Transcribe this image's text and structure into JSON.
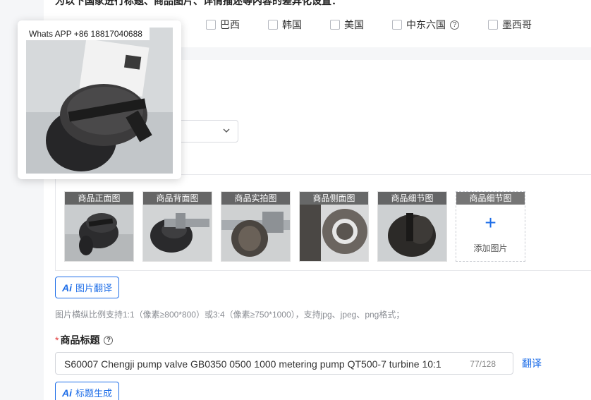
{
  "top_note": "为以下国家进行标题、商品图片、详情描述等内容的差异化设置：",
  "countries": [
    {
      "label": "巴西",
      "help": false
    },
    {
      "label": "韩国",
      "help": false
    },
    {
      "label": "美国",
      "help": false
    },
    {
      "label": "中东六国",
      "help": true
    },
    {
      "label": "墨西哥",
      "help": false
    }
  ],
  "help_glyph": "?",
  "images": [
    {
      "caption": "商品正面图"
    },
    {
      "caption": "商品背面图"
    },
    {
      "caption": "商品实拍图"
    },
    {
      "caption": "商品侧面图"
    },
    {
      "caption": "商品细节图"
    }
  ],
  "add_slot": {
    "caption": "商品细节图",
    "plus": "+",
    "label": "添加图片"
  },
  "image_translate_button": {
    "ai": "Ai",
    "label": "图片翻译"
  },
  "image_hint": "图片横纵比例支持1:1（像素≥800*800）或3:4（像素≥750*1000），支持jpg、jpeg、png格式；",
  "title_field": {
    "required_mark": "*",
    "label": "商品标题",
    "value": "S60007 Chengji pump valve GB0350 0500 1000 metering pump QT500-7 turbine 10:1",
    "count": "77/128",
    "translate": "翻译"
  },
  "title_gen_button": {
    "ai": "Ai",
    "label": "标题生成"
  },
  "popup": {
    "watermark": "Whats APP +86 18817040688"
  },
  "select": {
    "chevron": "⌄"
  },
  "colors": {
    "accent": "#1e6ee8",
    "required": "#e23c3c"
  }
}
